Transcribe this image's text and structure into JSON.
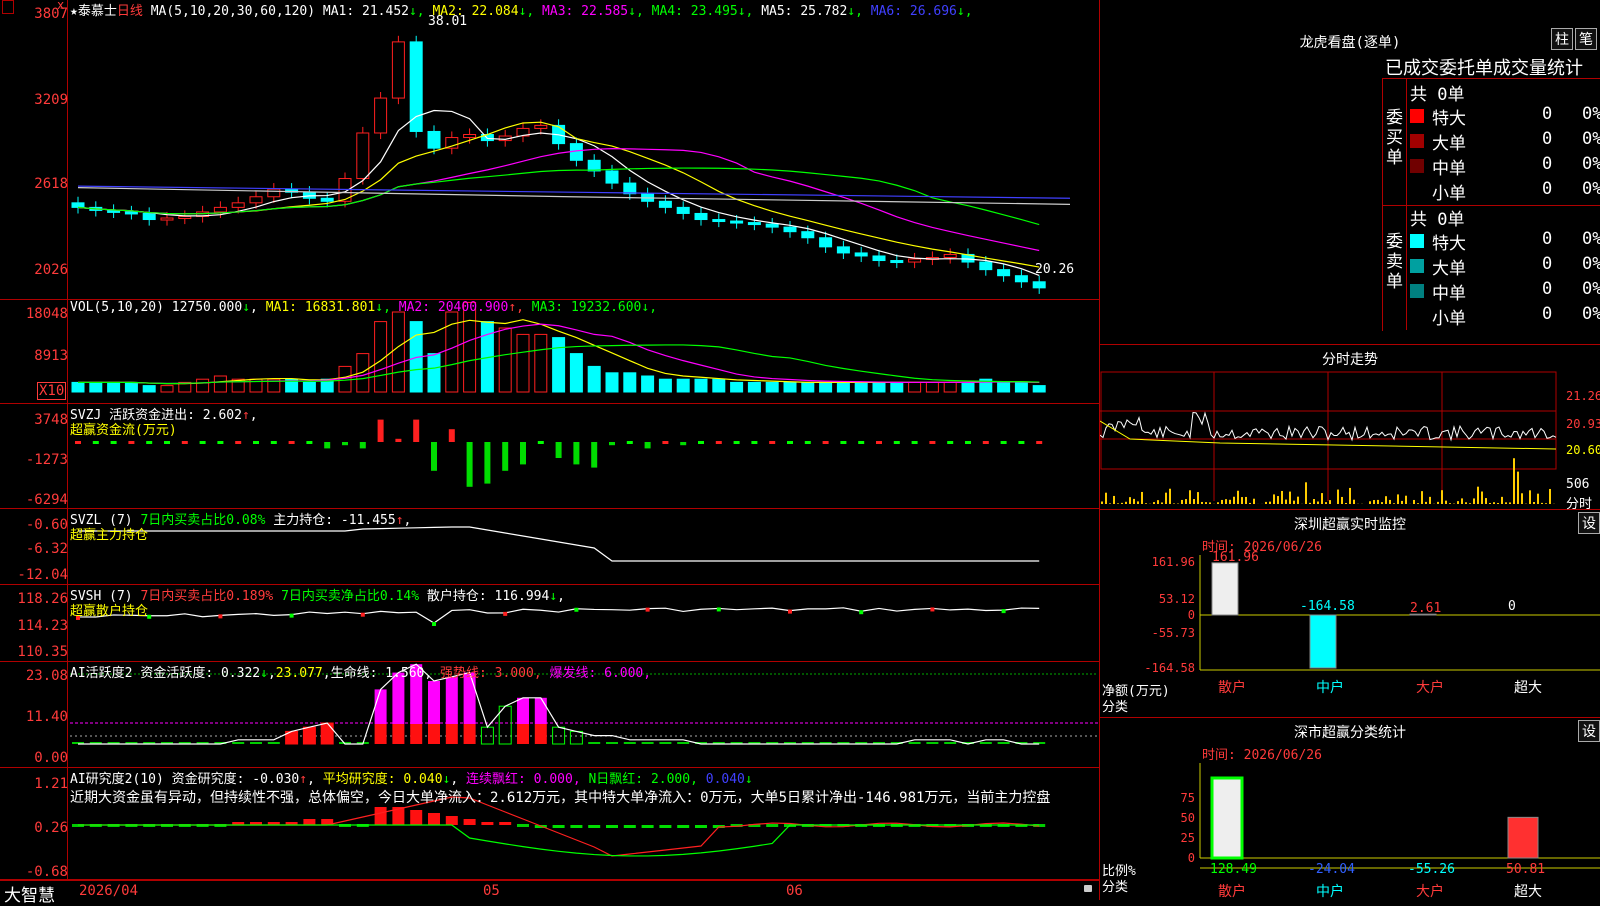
{
  "window": {
    "logo": "大智慧"
  },
  "main_chart": {
    "stock_name": "泰慕士",
    "period": "日线",
    "ma_params": "MA(5,10,20,30,60,120)",
    "ma": [
      {
        "label": "MA1:",
        "value": "21.452",
        "arrow": "↓",
        "color": "#ffffff"
      },
      {
        "label": "MA2:",
        "value": "22.084",
        "arrow": "↓",
        "color": "#ffff00"
      },
      {
        "label": "MA3:",
        "value": "22.585",
        "arrow": "↓",
        "color": "#ff00ff"
      },
      {
        "label": "MA4:",
        "value": "23.495",
        "arrow": "↓",
        "color": "#00ff00"
      },
      {
        "label": "MA5:",
        "value": "25.782",
        "arrow": "↓",
        "color": "#ffffff"
      },
      {
        "label": "MA6:",
        "value": "26.696",
        "arrow": "↓",
        "color": "#4040ff"
      }
    ],
    "yaxis": [
      "3807",
      "3209",
      "2618",
      "2026"
    ],
    "high_label": "38.01",
    "low_label": "20.26",
    "xaxis": [
      "2026/04",
      "05",
      "06"
    ]
  },
  "volume": {
    "legend_name": "VOL(5,10,20)",
    "value": "12750.000",
    "value_arrow": "↓",
    "ma": [
      {
        "label": "MA1:",
        "value": "16831.801",
        "arrow": "↓",
        "color": "#ffff00"
      },
      {
        "label": "MA2:",
        "value": "20400.900",
        "arrow": "↑",
        "color": "#ff00ff"
      },
      {
        "label": "MA3:",
        "value": "19232.600",
        "arrow": "↓",
        "color": "#00ff00"
      }
    ],
    "yaxis": [
      "18048",
      "8913"
    ],
    "unit": "X10"
  },
  "svzj": {
    "name": "SVZJ",
    "label": "活跃资金进出:",
    "value": "2.602",
    "arrow": "↑",
    "subtitle": "超赢资金流(万元)",
    "yaxis": [
      "3748",
      "-1273",
      "-6294"
    ]
  },
  "svzl": {
    "name": "SVZL (7)",
    "text1": "7日内买卖占比0.08%",
    "label2": "主力持仓:",
    "value2": "-11.455",
    "arrow2": "↑",
    "subtitle": "超赢主力持仓",
    "yaxis": [
      "-0.60",
      "-6.32",
      "-12.04"
    ]
  },
  "svsh": {
    "name": "SVSH (7)",
    "text1": "7日内买卖占比0.189%",
    "text2": "7日内买卖净占比0.14%",
    "label3": "散户持仓:",
    "value3": "116.994",
    "arrow3": "↓",
    "subtitle": "超赢散户持仓",
    "yaxis": [
      "118.26",
      "114.23",
      "110.35"
    ]
  },
  "ai_active": {
    "name": "AI活跃度2",
    "label": "资金活跃度:",
    "value": "0.322",
    "arrow": "↓",
    "value2": "23.077",
    "label3": "生命线:",
    "value3": "1.560",
    "label4": "强势线:",
    "value4": "3.000",
    "label5": "爆发线:",
    "value5": "6.000",
    "yaxis": [
      "23.08",
      "11.40",
      "0.00"
    ]
  },
  "ai_research": {
    "name": "AI研究度2(10)",
    "label": "资金研究度:",
    "value": "-0.030",
    "arrow": "↑",
    "label2": "平均研究度:",
    "value2": "0.040",
    "arrow2": "↓",
    "label3": "连续飘红:",
    "value3": "0.000",
    "label4": "N日飘红:",
    "value4": "2.000",
    "value5": "0.040",
    "arrow5": "↓",
    "comment": "近期大资金虽有异动，但持续性不强，总体偏空，今日大单净流入：2.612万元，其中特大单净流入：0万元，大单5日累计净出-146.981万元，当前主力控盘",
    "yaxis": [
      "1.21",
      "0.26",
      "-0.68"
    ]
  },
  "lhb": {
    "title": "龙虎看盘(逐单)",
    "btn_bar": "柱",
    "btn_order": "笔",
    "subtitle": "已成交委托单成交量统计",
    "buy": {
      "side": "委买单",
      "total": "共 0单",
      "rows": [
        {
          "label": "特大",
          "count": "0",
          "pct": "0%",
          "color": "#ff0000"
        },
        {
          "label": "大单",
          "count": "0",
          "pct": "0%",
          "color": "#a00000"
        },
        {
          "label": "中单",
          "count": "0",
          "pct": "0%",
          "color": "#700000"
        },
        {
          "label": "小单",
          "count": "0",
          "pct": "0%",
          "color": ""
        }
      ]
    },
    "sell": {
      "side": "委卖单",
      "total": "共 0单",
      "rows": [
        {
          "label": "特大",
          "count": "0",
          "pct": "0%",
          "color": "#00ffff"
        },
        {
          "label": "大单",
          "count": "0",
          "pct": "0%",
          "color": "#00a0a0"
        },
        {
          "label": "中单",
          "count": "0",
          "pct": "0%",
          "color": "#008080"
        },
        {
          "label": "小单",
          "count": "0",
          "pct": "0%",
          "color": ""
        }
      ]
    }
  },
  "intraday": {
    "title": "分时走势",
    "yaxis": [
      "21.26",
      "20.93",
      "20.60"
    ],
    "vol_label": "506",
    "vol_unit": "分时"
  },
  "sz_monitor": {
    "title": "深圳超赢实时监控",
    "btn": "设",
    "time": "时间: 2026/06/26",
    "yaxis": [
      "161.96",
      "53.12",
      "0",
      "-55.73",
      "-164.58"
    ],
    "net_label": "净额(万元)",
    "cat_label": "分类",
    "chart_data": {
      "type": "bar",
      "categories": [
        "散户",
        "中户",
        "大户",
        "超大"
      ],
      "values": [
        161.96,
        -164.58,
        2.61,
        0
      ],
      "value_labels": [
        "161.96",
        "-164.58",
        "2.61",
        "0"
      ],
      "ylim": [
        -164.58,
        161.96
      ]
    }
  },
  "sz_class": {
    "title": "深市超赢分类统计",
    "btn": "设",
    "time": "时间: 2026/06/26",
    "yaxis": [
      "75",
      "50",
      "25",
      "0"
    ],
    "ratio_label": "比例%",
    "cat_label": "分类",
    "chart_data": {
      "type": "bar",
      "categories": [
        "散户",
        "中户",
        "大户",
        "超大"
      ],
      "values": [
        128.49,
        -24.04,
        -55.26,
        50.81
      ],
      "value_labels": [
        "128.49",
        "-24.04",
        "-55.26",
        "50.81"
      ],
      "ylim": [
        0,
        100
      ]
    }
  }
}
